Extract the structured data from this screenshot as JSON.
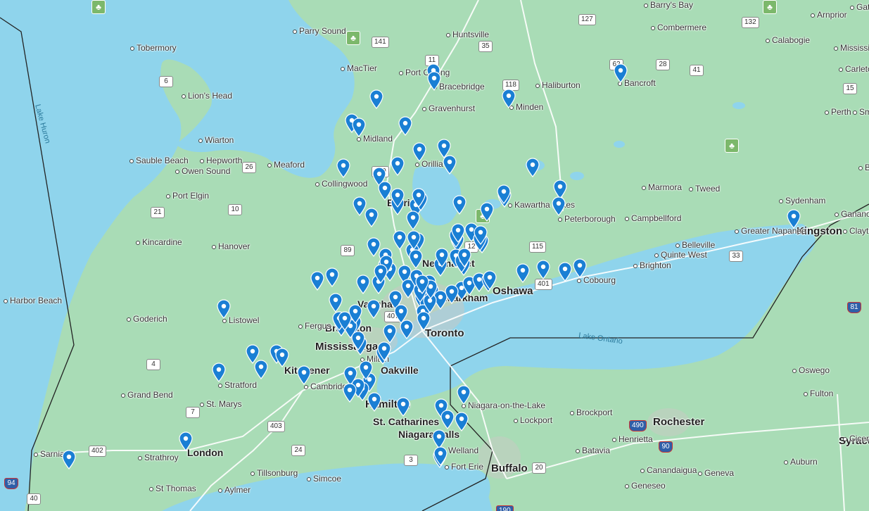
{
  "map": {
    "colors": {
      "water": "#8fd4ec",
      "land": "#a9dcb6",
      "pin": "#1a7fd4",
      "border": "#222222",
      "road": "#ffffff"
    },
    "water_labels": [
      "Lake Huron",
      "Lake Ontario"
    ],
    "major_cities": [
      "Toronto",
      "Mississauga",
      "Hamilton",
      "Oshawa",
      "Kingston",
      "Rochester",
      "Buffalo",
      "Syracu"
    ],
    "medium_cities": [
      "Oakville",
      "St. Catharines",
      "Niagara Falls",
      "London",
      "Kitchener",
      "Barrie",
      "Vaughan",
      "Markham",
      "Brampton",
      "Newmarket"
    ],
    "towns": [
      "Barry's Bay",
      "Gati",
      "Arnprior",
      "Parry Sound",
      "Huntsville",
      "Combermere",
      "Calabogie",
      "Mississippi Mills",
      "Carleton",
      "Tobermory",
      "MacTier",
      "Port Carling",
      "Bracebridge",
      "Haliburton",
      "Bancroft",
      "Lion's Head",
      "Gravenhurst",
      "Minden",
      "Perth",
      "Sm",
      "Wiarton",
      "Midland",
      "Sauble Beach",
      "Hepworth",
      "Owen Sound",
      "Meaford",
      "Orillia",
      "Bro",
      "Collingwood",
      "Marmora",
      "Tweed",
      "Sydenham",
      "Port Elgin",
      "Kawartha Lakes",
      "Ganano",
      "Peterborough",
      "Campbellford",
      "Clayto",
      "Kincardine",
      "Greater Napanee",
      "Hanover",
      "Belleville",
      "Quinte West",
      "Brighton",
      "Cobourg",
      "Harbor Beach",
      "Listowel",
      "Goderich",
      "Fergus",
      "Stratford",
      "Cambridge",
      "Milton",
      "Grand Bend",
      "St. Marys",
      "Niagara-on-the-Lake",
      "Brockport",
      "Lockport",
      "Oswego",
      "Fulton",
      "Cicero",
      "Sarnia",
      "Strathroy",
      "Welland",
      "Fort Erie",
      "Batavia",
      "Henrietta",
      "Auburn",
      "Tillsonburg",
      "Simcoe",
      "Canandaigua",
      "Geneva",
      "St Thomas",
      "Aylmer",
      "Geneseo"
    ],
    "highway_shields": [
      "127",
      "141",
      "11",
      "35",
      "118",
      "62",
      "28",
      "41",
      "132",
      "15",
      "7",
      "6",
      "26",
      "400",
      "21",
      "10",
      "89",
      "115",
      "401",
      "33",
      "407",
      "4",
      "403",
      "402",
      "24",
      "3",
      "190",
      "20",
      "490",
      "90",
      "81",
      "94",
      "40",
      "12"
    ],
    "park_icon": "maple-leaf-icon",
    "pin_icon": "location-pin-icon",
    "pin_count": 124
  }
}
